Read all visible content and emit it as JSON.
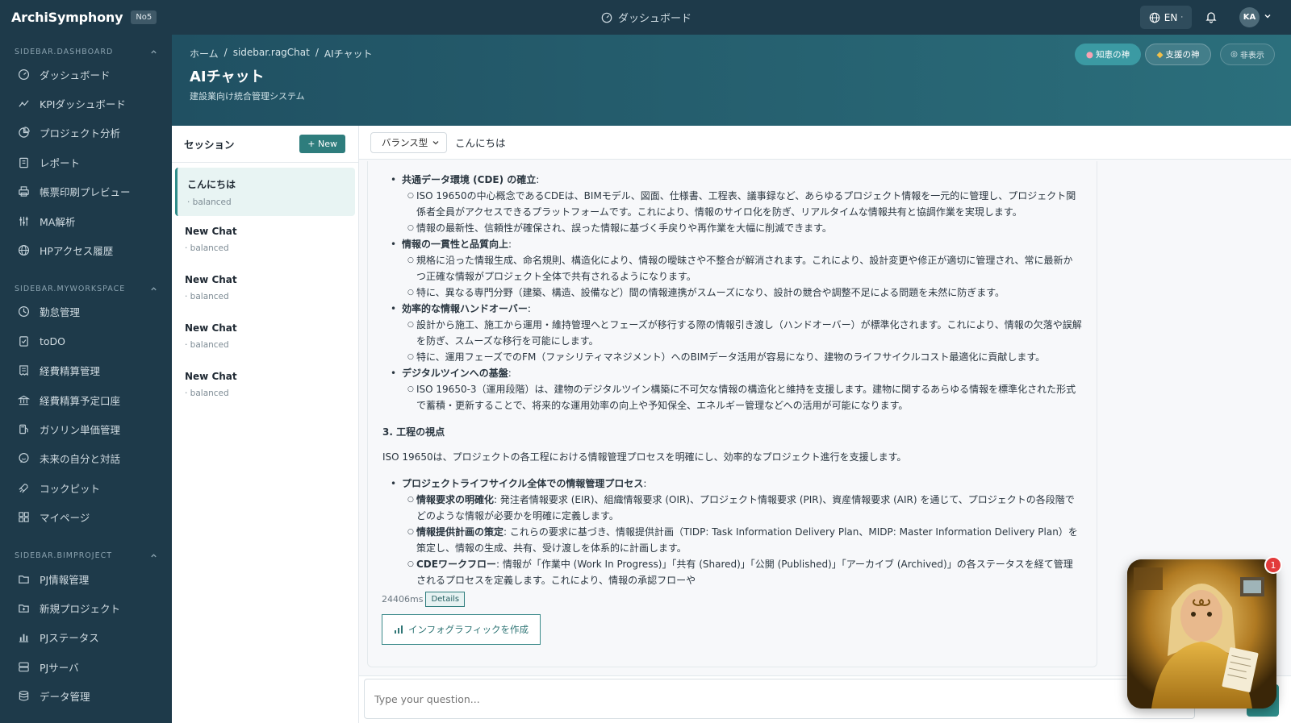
{
  "app": {
    "brand": "ArchiSymphony",
    "badge": "No5"
  },
  "topbar": {
    "center_label": "ダッシュボード",
    "lang": "EN",
    "avatar_initials": "KA"
  },
  "sidebar": {
    "sections": [
      {
        "title": "SIDEBAR.DASHBOARD",
        "items": [
          {
            "label": "ダッシュボード",
            "icon": "gauge-icon"
          },
          {
            "label": "KPIダッシュボード",
            "icon": "chart-icon"
          },
          {
            "label": "プロジェクト分析",
            "icon": "pie-icon"
          },
          {
            "label": "レポート",
            "icon": "clipboard-icon"
          },
          {
            "label": "帳票印刷プレビュー",
            "icon": "printer-icon"
          },
          {
            "label": "MA解析",
            "icon": "sliders-icon"
          },
          {
            "label": "HPアクセス履歴",
            "icon": "globe-icon"
          }
        ]
      },
      {
        "title": "SIDEBAR.MYWORKSPACE",
        "items": [
          {
            "label": "勤怠管理",
            "icon": "clock-icon"
          },
          {
            "label": "toDO",
            "icon": "todo-icon"
          },
          {
            "label": "経費精算管理",
            "icon": "receipt-icon"
          },
          {
            "label": "経費精算予定口座",
            "icon": "bank-icon"
          },
          {
            "label": "ガソリン単価管理",
            "icon": "fuel-icon"
          },
          {
            "label": "未来の自分と対話",
            "icon": "chat-bubble-icon"
          },
          {
            "label": "コックピット",
            "icon": "rocket-icon"
          },
          {
            "label": "マイページ",
            "icon": "grid-icon"
          }
        ]
      },
      {
        "title": "SIDEBAR.BIMPROJECT",
        "items": [
          {
            "label": "PJ情報管理",
            "icon": "folder-icon"
          },
          {
            "label": "新規プロジェクト",
            "icon": "folder-plus-icon"
          },
          {
            "label": "PJステータス",
            "icon": "bar-chart-icon"
          },
          {
            "label": "PJサーバ",
            "icon": "server-icon"
          },
          {
            "label": "データ管理",
            "icon": "database-icon"
          }
        ]
      }
    ]
  },
  "header": {
    "breadcrumb": [
      "ホーム",
      "/",
      "sidebar.ragChat",
      "/",
      "AIチャット"
    ],
    "title": "AIチャット",
    "subtitle": "建設業向け統合管理システム",
    "mode_wise": "知恵の神",
    "mode_support": "支援の神",
    "mode_hide": "非表示"
  },
  "sessions": {
    "title": "セッション",
    "new_label": "+ New",
    "items": [
      {
        "title": "こんにちは",
        "mode": "· balanced",
        "active": true
      },
      {
        "title": "New Chat",
        "mode": "· balanced"
      },
      {
        "title": "New Chat",
        "mode": "· balanced"
      },
      {
        "title": "New Chat",
        "mode": "· balanced"
      },
      {
        "title": "New Chat",
        "mode": "· balanced"
      }
    ]
  },
  "chat": {
    "mode_select": "バランス型",
    "title": "こんにちは",
    "message": {
      "s1_title": "共通データ環境 (CDE) の確立",
      "s1_a": "ISO 19650の中心概念であるCDEは、BIMモデル、図面、仕様書、工程表、議事録など、あらゆるプロジェクト情報を一元的に管理し、プロジェクト関係者全員がアクセスできるプラットフォームです。これにより、情報のサイロ化を防ぎ、リアルタイムな情報共有と協調作業を実現します。",
      "s1_b": "情報の最新性、信頼性が確保され、誤った情報に基づく手戻りや再作業を大幅に削減できます。",
      "s2_title": "情報の一貫性と品質向上",
      "s2_a": "規格に沿った情報生成、命名規則、構造化により、情報の曖昧さや不整合が解消されます。これにより、設計変更や修正が適切に管理され、常に最新かつ正確な情報がプロジェクト全体で共有されるようになります。",
      "s2_b": "特に、異なる専門分野（建築、構造、設備など）間の情報連携がスムーズになり、設計の競合や調整不足による問題を未然に防ぎます。",
      "s3_title": "効率的な情報ハンドオーバー",
      "s3_a": "設計から施工、施工から運用・維持管理へとフェーズが移行する際の情報引き渡し（ハンドオーバー）が標準化されます。これにより、情報の欠落や誤解を防ぎ、スムーズな移行を可能にします。",
      "s3_b": "特に、運用フェーズでのFM（ファシリティマネジメント）へのBIMデータ活用が容易になり、建物のライフサイクルコスト最適化に貢献します。",
      "s4_title": "デジタルツインへの基盤",
      "s4_a": "ISO 19650-3（運用段階）は、建物のデジタルツイン構築に不可欠な情報の構造化と維持を支援します。建物に関するあらゆる情報を標準化された形式で蓄積・更新することで、将来的な運用効率の向上や予知保全、エネルギー管理などへの活用が可能になります。",
      "h3": "3. 工程の視点",
      "para": "ISO 19650は、プロジェクトの各工程における情報管理プロセスを明確にし、効率的なプロジェクト進行を支援します。",
      "s5_title": "プロジェクトライフサイクル全体での情報管理プロセス",
      "s5_a_label": "情報要求の明確化",
      "s5_a": ": 発注者情報要求 (EIR)、組織情報要求 (OIR)、プロジェクト情報要求 (PIR)、資産情報要求 (AIR) を通じて、プロジェクトの各段階でどのような情報が必要かを明確に定義します。",
      "s5_b_label": "情報提供計画の策定",
      "s5_b": ": これらの要求に基づき、情報提供計画（TIDP: Task Information Delivery Plan、MIDP: Master Information Delivery Plan）を策定し、情報の生成、共有、受け渡しを体系的に計画します。",
      "s5_c_label": "CDEワークフロー",
      "s5_c": ": 情報が「作業中 (Work In Progress)」「共有 (Shared)」「公開 (Published)」「アーカイブ (Archived)」の各ステータスを経て管理されるプロセスを定義します。これにより、情報の承認フローや"
    },
    "elapsed": "24406ms",
    "details_label": "Details",
    "infographic_label": "インフォグラフィックを作成",
    "input_placeholder": "Type your question...",
    "notification_count": "1"
  },
  "colors": {
    "sidebar": "#1e3a4a",
    "accent": "#2e8c89",
    "header_from": "#205062",
    "header_to": "#2b6f7c"
  }
}
